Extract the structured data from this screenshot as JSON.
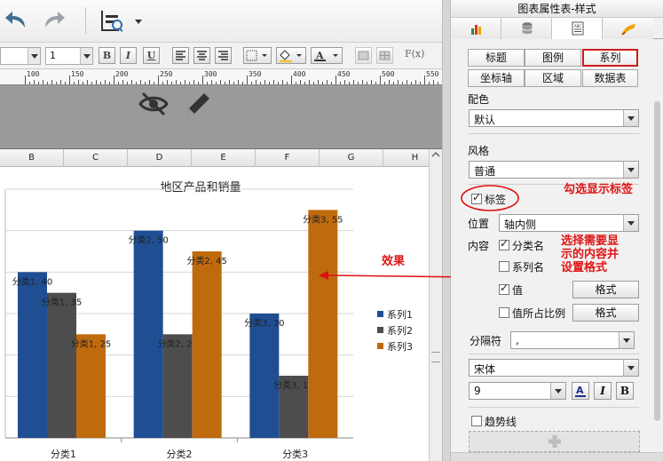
{
  "toolbar": {
    "font_size_value": "1",
    "bold_label": "B",
    "italic_label": "I",
    "underline_label": "U",
    "fx_label": "F(x)"
  },
  "ruler": {
    "labels": [
      "100",
      "150",
      "200",
      "250",
      "300",
      "350",
      "400",
      "450",
      "500",
      "550"
    ]
  },
  "columns": [
    "B",
    "C",
    "D",
    "E",
    "F",
    "G",
    "H"
  ],
  "chart_data": {
    "type": "bar",
    "title": "地区产品和销量",
    "categories": [
      "分类1",
      "分类2",
      "分类3"
    ],
    "series": [
      {
        "name": "系列1",
        "color": "#1f4e93",
        "values": [
          40,
          50,
          30
        ],
        "labels": [
          "分类1, 40",
          "分类2, 50",
          "分类3, 30"
        ]
      },
      {
        "name": "系列2",
        "color": "#4d4d4d",
        "values": [
          35,
          25,
          15
        ],
        "labels": [
          "分类1, 35",
          "分类2, 25",
          "分类3, 15"
        ]
      },
      {
        "name": "系列3",
        "color": "#c06a0e",
        "values": [
          25,
          45,
          55
        ],
        "labels": [
          "分类1, 25",
          "分类2, 45",
          "分类3, 55"
        ]
      }
    ],
    "ylim": [
      0,
      60
    ],
    "grid": true,
    "legend": "right"
  },
  "annotations": {
    "effect": "效果",
    "check_label_tip": "勾选显示标签",
    "choose_content_tip_1": "选择需要显",
    "choose_content_tip_2": "示的内容并",
    "choose_content_tip_3": "设置格式"
  },
  "panel": {
    "title": "图表属性表-样式",
    "tabs_row1": [
      "标题",
      "图例",
      "系列"
    ],
    "tabs_row2": [
      "坐标轴",
      "区域",
      "数据表"
    ],
    "selected_tab": "系列",
    "color_label": "配色",
    "color_value": "默认",
    "style_label": "风格",
    "style_value": "普通",
    "label_checkbox": "标签",
    "position_label": "位置",
    "position_value": "轴内侧",
    "content_label": "内容",
    "opt_category": "分类名",
    "opt_series": "系列名",
    "opt_value": "值",
    "opt_percent": "值所占比例",
    "format_button": "格式",
    "separator_label": "分隔符",
    "separator_value": ",",
    "font_value": "宋体",
    "font_size_value": "9",
    "bold_label": "B",
    "italic_label": "I",
    "trendline_label": "趋势线",
    "colors": {
      "selected_tab_border": "#d11a1a",
      "annotation": "#e01414"
    }
  }
}
